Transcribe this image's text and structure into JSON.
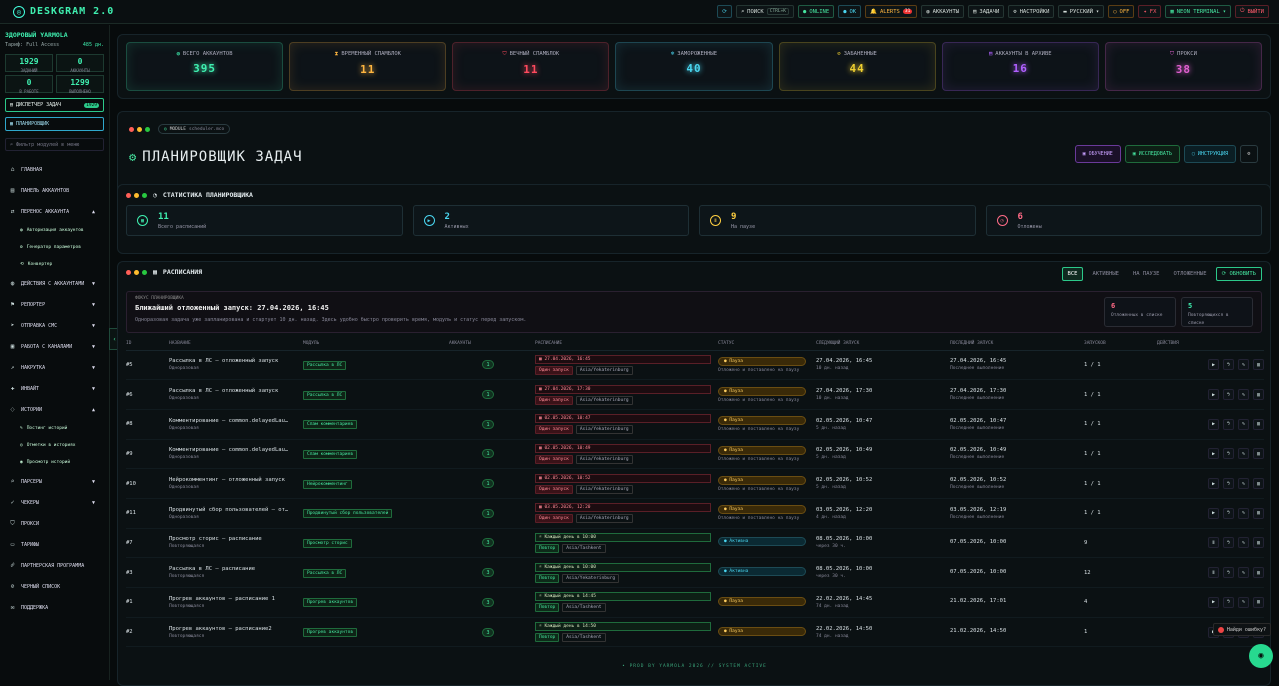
{
  "app": {
    "name": "DESKGRAM 2.0"
  },
  "topbar": {
    "search": "ПОИСК",
    "search_kbd": "CTRL+K",
    "online": "ONLINE",
    "ok": "OK",
    "alerts": "ALERTS",
    "alerts_count": "31",
    "accounts": "АККАУНТЫ",
    "tasks": "ЗАДАЧИ",
    "settings": "НАСТРОЙКИ",
    "lang": "РУССКИЙ",
    "off": "OFF",
    "fx": "FX",
    "theme": "NEON TERMINAL",
    "logout": "ВЫЙТИ"
  },
  "sidebar": {
    "profile_name": "ЗДОРОВЫЙ YARMOLA",
    "tariff": "Тариф: Full Access",
    "days": "485 дн.",
    "stats": [
      {
        "v": "1929",
        "l": "ЗАДАНИЙ"
      },
      {
        "v": "0",
        "l": "АККАУНТЫ"
      },
      {
        "v": "0",
        "l": "В РАБОТЕ"
      },
      {
        "v": "1299",
        "l": "ВЫПОЛНЕНО"
      }
    ],
    "dispatcher": "ДИСПЕТЧЕР ЗАДАЧ",
    "dispatcher_count": "1929",
    "planner": "ПЛАНИРОВЩИК",
    "filter_placeholder": "Фильтр модулей в меню",
    "items": [
      {
        "label": "ГЛАВНАЯ",
        "icon": "home-icon",
        "arrow": ""
      },
      {
        "label": "ПАНЕЛЬ АККАУНТОВ",
        "icon": "panel-icon",
        "arrow": ""
      },
      {
        "label": "ПЕРЕНОС АККАУНТА",
        "icon": "transfer-icon",
        "arrow": "▲"
      }
    ],
    "sub1": [
      {
        "label": "Авторизация аккаунтов",
        "icon": "user-icon"
      },
      {
        "label": "Генератор параметров",
        "icon": "gear-icon"
      },
      {
        "label": "Конвертер",
        "icon": "convert-icon"
      }
    ],
    "items2": [
      {
        "label": "ДЕЙСТВИЯ С АККАУНТАМИ",
        "icon": "user-icon",
        "arrow": "▼"
      },
      {
        "label": "РЕПОРТЕР",
        "icon": "flag-icon",
        "arrow": "▼"
      },
      {
        "label": "ОТПРАВКА СМС",
        "icon": "send-icon",
        "arrow": "▼"
      },
      {
        "label": "РАБОТА С КАНАЛАМИ",
        "icon": "channel-icon",
        "arrow": "▼"
      },
      {
        "label": "НАКРУТКА",
        "icon": "chart-icon",
        "arrow": "▼"
      },
      {
        "label": "ИНВАЙТ",
        "icon": "invite-icon",
        "arrow": "▼"
      },
      {
        "label": "ИСТОРИИ",
        "icon": "stories-icon",
        "arrow": "▲"
      }
    ],
    "sub2": [
      {
        "label": "Постинг историй",
        "icon": "post-icon"
      },
      {
        "label": "Отметки в историях",
        "icon": "mark-icon"
      },
      {
        "label": "Просмотр историй",
        "icon": "eye-icon"
      }
    ],
    "items3": [
      {
        "label": "ПАРСЕРЫ",
        "icon": "parser-icon",
        "arrow": "▼"
      },
      {
        "label": "ЧЕКЕРЫ",
        "icon": "check-icon",
        "arrow": "▼"
      },
      {
        "label": "ПРОКСИ",
        "icon": "proxy-icon",
        "arrow": ""
      },
      {
        "label": "ТАРИФЫ",
        "icon": "tariff-icon",
        "arrow": ""
      },
      {
        "label": "ПАРТНЕРСКАЯ ПРОГРАММА",
        "icon": "partner-icon",
        "arrow": ""
      },
      {
        "label": "ЧЕРНЫЙ СПИСОК",
        "icon": "blacklist-icon",
        "arrow": ""
      },
      {
        "label": "ПОДДЕРЖКА",
        "icon": "support-icon",
        "arrow": ""
      }
    ]
  },
  "cards": [
    {
      "label": "ВСЕГО АККАУНТОВ",
      "value": "395",
      "color": "#3ff0b0",
      "icon": "users-icon",
      "g": "◍"
    },
    {
      "label": "ВРЕМЕННЫЙ СПАМБЛОК",
      "value": "11",
      "color": "#ffb640",
      "icon": "hourglass-icon",
      "g": "⧗"
    },
    {
      "label": "ВЕЧНЫЙ СПАМБЛОК",
      "value": "11",
      "color": "#ff4a5e",
      "icon": "shield-icon",
      "g": "⛉"
    },
    {
      "label": "ЗАМОРОЖЕННЫЕ",
      "value": "40",
      "color": "#4ad6f0",
      "icon": "snow-icon",
      "g": "❄"
    },
    {
      "label": "ЗАБАНЕННЫЕ",
      "value": "44",
      "color": "#f0d030",
      "icon": "ban-icon",
      "g": "⊘"
    },
    {
      "label": "АККАУНТЫ В АРХИВЕ",
      "value": "16",
      "color": "#b060ff",
      "icon": "archive-icon",
      "g": "▤"
    },
    {
      "label": "ПРОКСИ",
      "value": "38",
      "color": "#e060d0",
      "icon": "proxy-icon",
      "g": "⛉"
    }
  ],
  "header": {
    "module": "MODULE",
    "module_sub": "scheduler.mco",
    "title": "ПЛАНИРОВЩИК ЗАДАЧ",
    "learn": "ОБУЧЕНИЕ",
    "research": "ИССЛЕДОВАТЬ",
    "guide": "ИНСТРУКЦИЯ"
  },
  "stats": {
    "title": "СТАТИСТИКА ПЛАНИРОВЩИКА",
    "items": [
      {
        "v": "11",
        "l": "Всего расписаний",
        "color": "#3ff0b0",
        "g": "▦"
      },
      {
        "v": "2",
        "l": "Активных",
        "color": "#4ad6f0",
        "g": "▶"
      },
      {
        "v": "9",
        "l": "На паузе",
        "color": "#ffcf40",
        "g": "Ⅱ"
      },
      {
        "v": "6",
        "l": "Отложены",
        "color": "#ff6a86",
        "g": "◷"
      }
    ]
  },
  "schedules": {
    "title": "РАСПИСАНИЯ",
    "tabs": [
      "ВСЕ",
      "АКТИВНЫЕ",
      "НА ПАУЗЕ",
      "ОТЛОЖЕННЫЕ"
    ],
    "refresh": "ОБНОВИТЬ",
    "focus_k": "ФОКУС ПЛАНИРОВЩИКА",
    "focus_h": "Ближайший отложенный запуск: 27.04.2026, 16:45",
    "focus_d": "Одноразовая задача уже запланирована и стартует 10 дн. назад. Здесь удобно быстро проверить время, модуль и статус перед запуском.",
    "fc1_v": "6",
    "fc1_l": "Отложенных в списке",
    "fc2_v": "5",
    "fc2_l": "Повторяющихся в списке",
    "cols": [
      "ID",
      "НАЗВАНИЕ",
      "МОДУЛЬ",
      "АККАУНТЫ",
      "РАСПИСАНИЕ",
      "СТАТУС",
      "СЛЕДУЮЩИЙ ЗАПУСК",
      "ПОСЛЕДНИЙ ЗАПУСК",
      "ЗАПУСКОВ",
      "ДЕЙСТВИЯ"
    ],
    "rows": [
      {
        "id": "#5",
        "name": "Рассылка в ЛС — отложенный запуск",
        "kind": "Одноразовая",
        "module": "Рассылка в ЛС",
        "acc": "1",
        "sched": "27.04.2026, 16:45",
        "p1": "Один запуск",
        "p2": "Asia/Yekaterinburg",
        "status": "Пауза",
        "note": "Отложено и поставлено на паузу",
        "next": "27.04.2026, 16:45",
        "next_s": "10 дн. назад",
        "last": "27.04.2026, 16:45",
        "last_s": "Последнее выполнение",
        "runs": "1 / 1"
      },
      {
        "id": "#6",
        "name": "Рассылка в ЛС — отложенный запуск",
        "kind": "Одноразовая",
        "module": "Рассылка в ЛС",
        "acc": "1",
        "sched": "27.04.2026, 17:30",
        "p1": "Один запуск",
        "p2": "Asia/Yekaterinburg",
        "status": "Пауза",
        "note": "Отложено и поставлено на паузу",
        "next": "27.04.2026, 17:30",
        "next_s": "10 дн. назад",
        "last": "27.04.2026, 17:30",
        "last_s": "Последнее выполнение",
        "runs": "1 / 1"
      },
      {
        "id": "#8",
        "name": "Комментирование — common.delayedLau…",
        "kind": "Одноразовая",
        "module": "Спам комментариев",
        "acc": "1",
        "sched": "02.05.2026, 10:47",
        "p1": "Один запуск",
        "p2": "Asia/Yekaterinburg",
        "status": "Пауза",
        "note": "Отложено и поставлено на паузу",
        "next": "02.05.2026, 10:47",
        "next_s": "5 дн. назад",
        "last": "02.05.2026, 10:47",
        "last_s": "Последнее выполнение",
        "runs": "1 / 1"
      },
      {
        "id": "#9",
        "name": "Комментирование — common.delayedLau…",
        "kind": "Одноразовая",
        "module": "Спам комментариев",
        "acc": "1",
        "sched": "02.05.2026, 10:49",
        "p1": "Один запуск",
        "p2": "Asia/Yekaterinburg",
        "status": "Пауза",
        "note": "Отложено и поставлено на паузу",
        "next": "02.05.2026, 10:49",
        "next_s": "5 дн. назад",
        "last": "02.05.2026, 10:49",
        "last_s": "Последнее выполнение",
        "runs": "1 / 1"
      },
      {
        "id": "#10",
        "name": "Нейрокомментинг — отложенный запуск",
        "kind": "Одноразовая",
        "module": "Нейрокомментинг",
        "acc": "1",
        "sched": "02.05.2026, 10:52",
        "p1": "Один запуск",
        "p2": "Asia/Yekaterinburg",
        "status": "Пауза",
        "note": "Отложено и поставлено на паузу",
        "next": "02.05.2026, 10:52",
        "next_s": "5 дн. назад",
        "last": "02.05.2026, 10:52",
        "last_s": "Последнее выполнение",
        "runs": "1 / 1"
      },
      {
        "id": "#11",
        "name": "Продвинутый сбор пользователей — от…",
        "kind": "Одноразовая",
        "module": "Продвинутый сбор пользователей",
        "acc": "1",
        "sched": "03.05.2026, 12:20",
        "p1": "Один запуск",
        "p2": "Asia/Yekaterinburg",
        "status": "Пауза",
        "note": "Отложено и поставлено на паузу",
        "next": "03.05.2026, 12:20",
        "next_s": "4 дн. назад",
        "last": "03.05.2026, 12:19",
        "last_s": "Последнее выполнение",
        "runs": "1 / 1"
      },
      {
        "id": "#7",
        "name": "Просмотр сторис — расписание",
        "kind": "Повторяющаяся",
        "module": "Просмотр сторис",
        "acc": "3",
        "sched": "Каждый день в 10:00",
        "p1": "Повтор",
        "p2": "Asia/Tashkent",
        "status": "Активна",
        "note": "",
        "next": "08.05.2026, 10:00",
        "next_s": "через 30 ч.",
        "last": "07.05.2026, 10:00",
        "last_s": "",
        "runs": "9"
      },
      {
        "id": "#3",
        "name": "Рассылка в ЛС — расписание",
        "kind": "Повторяющаяся",
        "module": "Рассылка в ЛС",
        "acc": "3",
        "sched": "Каждый день в 10:00",
        "p1": "Повтор",
        "p2": "Asia/Yekaterinburg",
        "status": "Активна",
        "note": "",
        "next": "08.05.2026, 10:00",
        "next_s": "через 30 ч.",
        "last": "07.05.2026, 10:00",
        "last_s": "",
        "runs": "12"
      },
      {
        "id": "#1",
        "name": "Прогрев аккаунтов — расписание 1",
        "kind": "Повторяющаяся",
        "module": "Прогрев аккаунтов",
        "acc": "3",
        "sched": "Каждый день в 14:45",
        "p1": "Повтор",
        "p2": "Asia/Tashkent",
        "status": "Пауза",
        "note": "",
        "next": "22.02.2026, 14:45",
        "next_s": "74 дн. назад",
        "last": "21.02.2026, 17:01",
        "last_s": "",
        "runs": "4"
      },
      {
        "id": "#2",
        "name": "Прогрев аккаунтов — расписание2",
        "kind": "Повторяющаяся",
        "module": "Прогрев аккаунтов",
        "acc": "3",
        "sched": "Каждый день в 14:50",
        "p1": "Повтор",
        "p2": "Asia/Tashkent",
        "status": "Пауза",
        "note": "",
        "next": "22.02.2026, 14:50",
        "next_s": "74 дн. назад",
        "last": "21.02.2026, 14:50",
        "last_s": "",
        "runs": "1"
      }
    ]
  },
  "footer": "• PROD BY YARMOLA 2026   // SYSTEM ACTIVE",
  "toast": "Найди ошибку?"
}
